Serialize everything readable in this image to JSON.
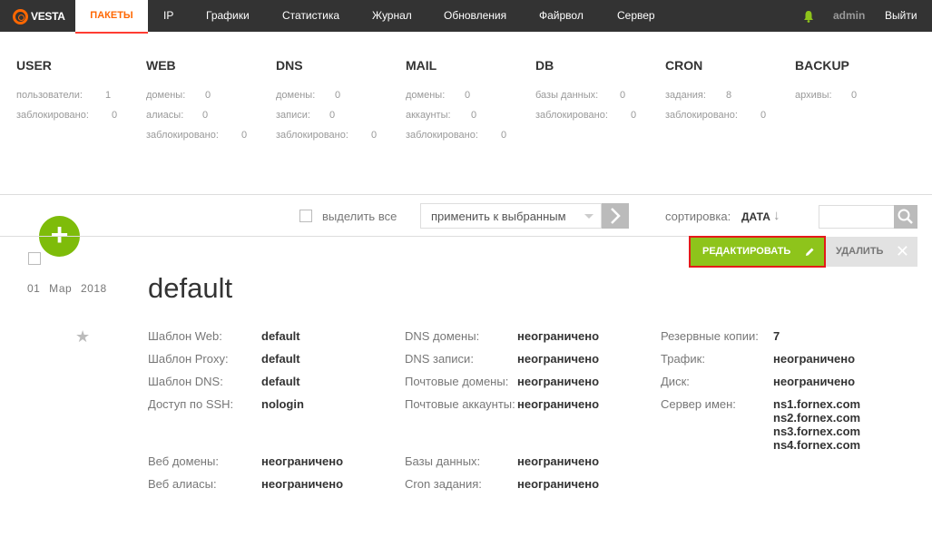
{
  "nav": {
    "logo": "VESTA",
    "active": "ПАКЕТЫ",
    "items": [
      "IP",
      "Графики",
      "Статистика",
      "Журнал",
      "Обновления",
      "Файрвол",
      "Сервер"
    ],
    "user": "admin",
    "logout": "Выйти"
  },
  "stats": [
    {
      "title": "USER",
      "rows": [
        {
          "label": "пользователи:",
          "value": "1"
        },
        {
          "label": "заблокировано:",
          "value": "0"
        }
      ]
    },
    {
      "title": "WEB",
      "rows": [
        {
          "label": "домены:",
          "value": "0"
        },
        {
          "label": "алиасы:",
          "value": "0"
        },
        {
          "label": "заблокировано:",
          "value": "0"
        }
      ]
    },
    {
      "title": "DNS",
      "rows": [
        {
          "label": "домены:",
          "value": "0"
        },
        {
          "label": "записи:",
          "value": "0"
        },
        {
          "label": "заблокировано:",
          "value": "0"
        }
      ]
    },
    {
      "title": "MAIL",
      "rows": [
        {
          "label": "домены:",
          "value": "0"
        },
        {
          "label": "аккаунты:",
          "value": "0"
        },
        {
          "label": "заблокировано:",
          "value": "0"
        }
      ]
    },
    {
      "title": "DB",
      "rows": [
        {
          "label": "базы данных:",
          "value": "0"
        },
        {
          "label": "заблокировано:",
          "value": "0"
        }
      ]
    },
    {
      "title": "CRON",
      "rows": [
        {
          "label": "задания:",
          "value": "8"
        },
        {
          "label": "заблокировано:",
          "value": "0"
        }
      ]
    },
    {
      "title": "BACKUP",
      "rows": [
        {
          "label": "архивы:",
          "value": "0"
        }
      ]
    }
  ],
  "toolbar": {
    "select_all": "выделить все",
    "apply": "применить к выбранным",
    "sort_label": "сортировка:",
    "sort_value": "ДАТА",
    "sort_arrow": "↓",
    "add": "+"
  },
  "package": {
    "name": "default",
    "date": "01 Мар 2018",
    "edit_label": "РЕДАКТИРОВАТЬ",
    "delete_label": "УДАЛИТЬ",
    "star": "★",
    "col1": [
      {
        "label": "Шаблон Web:",
        "value": "default"
      },
      {
        "label": "Шаблон Proxy:",
        "value": "default"
      },
      {
        "label": "Шаблон DNS:",
        "value": "default"
      },
      {
        "label": "Доступ по SSH:",
        "value": "nologin"
      },
      {
        "label": "Веб домены:",
        "value": "неограничено"
      },
      {
        "label": "Веб алиасы:",
        "value": "неограничено"
      }
    ],
    "col2": [
      {
        "label": "DNS домены:",
        "value": "неограничено"
      },
      {
        "label": "DNS записи:",
        "value": "неограничено"
      },
      {
        "label": "Почтовые домены:",
        "value": "неограничено"
      },
      {
        "label": "Почтовые аккаунты:",
        "value": "неограничено"
      },
      {
        "label": "Базы данных:",
        "value": "неограничено"
      },
      {
        "label": "Cron задания:",
        "value": "неограничено"
      }
    ],
    "col3": [
      {
        "label": "Резервные копии:",
        "value": "7"
      },
      {
        "label": "Трафик:",
        "value": "неограничено"
      },
      {
        "label": "Диск:",
        "value": "неограничено"
      },
      {
        "label": "Сервер имен:",
        "value": "ns1.fornex.com"
      }
    ],
    "nameservers_extra": [
      "ns2.fornex.com",
      "ns3.fornex.com",
      "ns4.fornex.com"
    ]
  }
}
